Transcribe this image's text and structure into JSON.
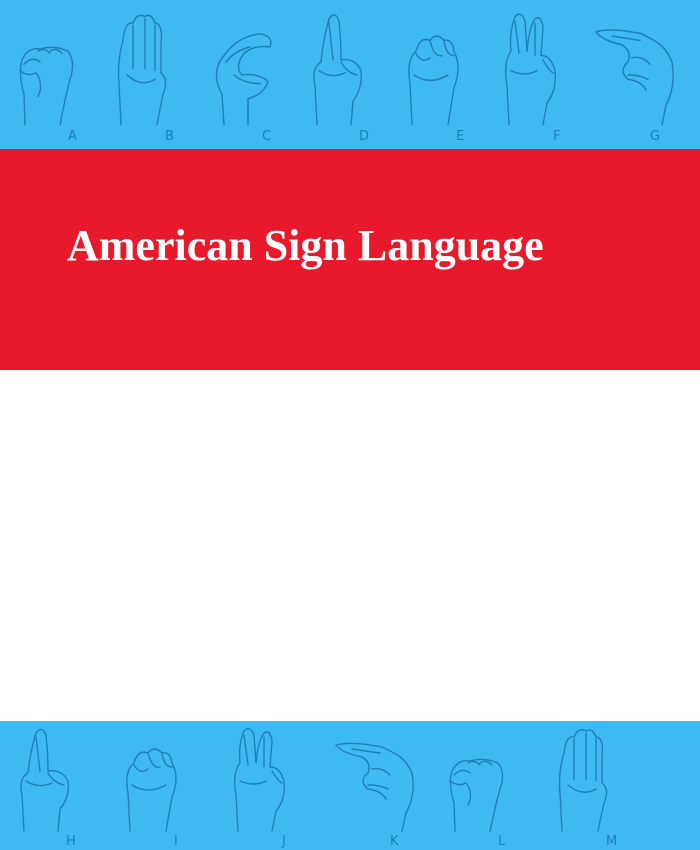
{
  "title": "American Sign Language",
  "colors": {
    "band_blue": "#3ebaf0",
    "line_blue": "#1f7fb8",
    "red": "#e8192a",
    "white": "#ffffff",
    "title_text": "#ffffff"
  },
  "top_letters": [
    "A",
    "B",
    "C",
    "D",
    "E",
    "F",
    "G"
  ],
  "bottom_letters": [
    "H",
    "I",
    "J",
    "K",
    "L",
    "M"
  ],
  "icons": [
    "sign-hand-icon"
  ]
}
